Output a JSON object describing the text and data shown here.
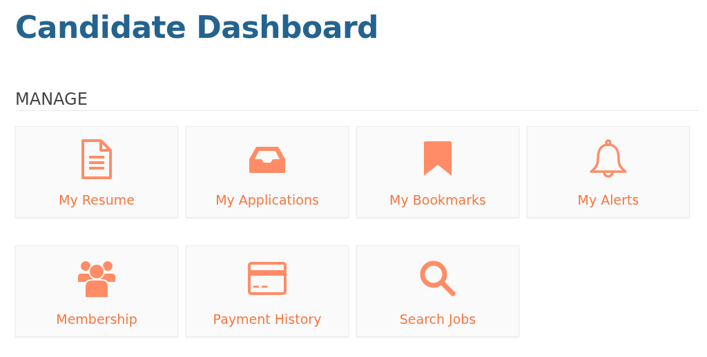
{
  "title": "Candidate Dashboard",
  "section": {
    "heading": "MANAGE"
  },
  "tiles": [
    {
      "label": "My Resume",
      "kind": "document"
    },
    {
      "label": "My Applications",
      "kind": "inbox"
    },
    {
      "label": "My Bookmarks",
      "kind": "bookmark"
    },
    {
      "label": "My Alerts",
      "kind": "bell"
    },
    {
      "label": "Membership",
      "kind": "users"
    },
    {
      "label": "Payment History",
      "kind": "card"
    },
    {
      "label": "Search Jobs",
      "kind": "search"
    }
  ]
}
